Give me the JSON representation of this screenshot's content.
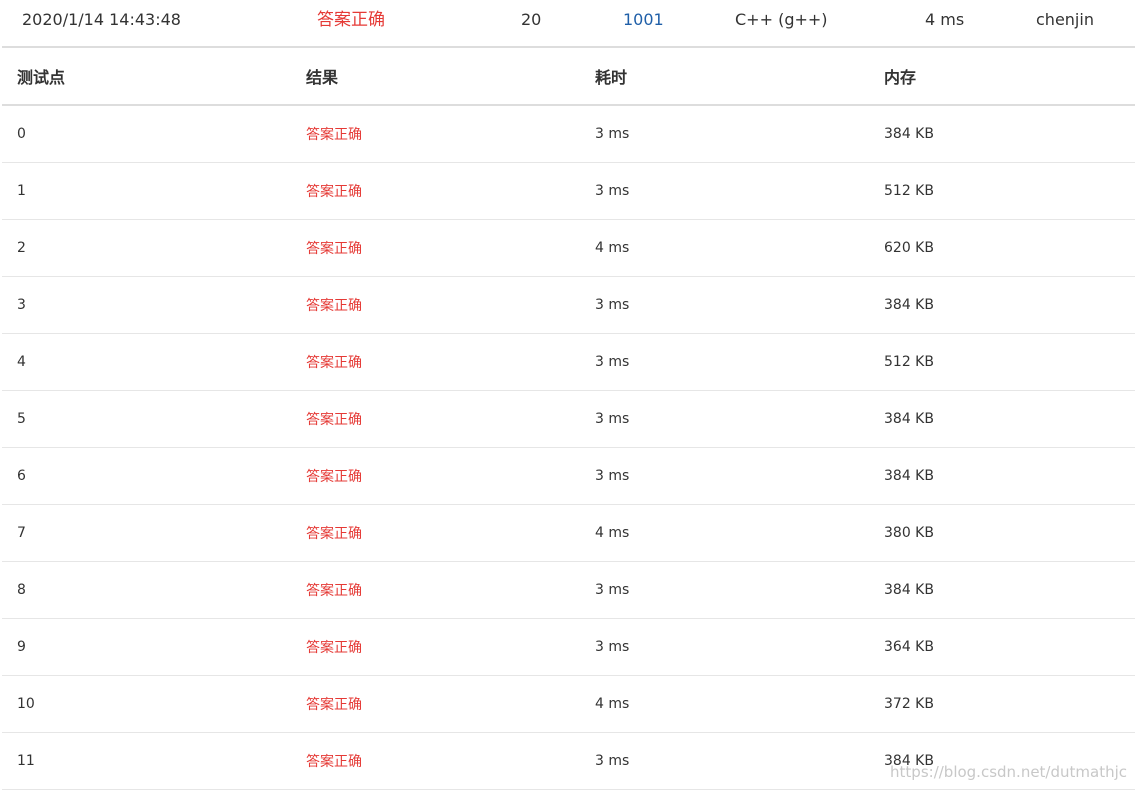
{
  "summary": {
    "submit_time": "2020/1/14 14:43:48",
    "status": "答案正确",
    "score": "20",
    "problem": "1001",
    "language": "C++ (g++)",
    "time_cost": "4 ms",
    "user": "chenjin"
  },
  "table": {
    "headers": {
      "case": "测试点",
      "result": "结果",
      "time": "耗时",
      "memory": "内存"
    },
    "rows": [
      {
        "case": "0",
        "result": "答案正确",
        "time": "3 ms",
        "memory": "384 KB"
      },
      {
        "case": "1",
        "result": "答案正确",
        "time": "3 ms",
        "memory": "512 KB"
      },
      {
        "case": "2",
        "result": "答案正确",
        "time": "4 ms",
        "memory": "620 KB"
      },
      {
        "case": "3",
        "result": "答案正确",
        "time": "3 ms",
        "memory": "384 KB"
      },
      {
        "case": "4",
        "result": "答案正确",
        "time": "3 ms",
        "memory": "512 KB"
      },
      {
        "case": "5",
        "result": "答案正确",
        "time": "3 ms",
        "memory": "384 KB"
      },
      {
        "case": "6",
        "result": "答案正确",
        "time": "3 ms",
        "memory": "384 KB"
      },
      {
        "case": "7",
        "result": "答案正确",
        "time": "4 ms",
        "memory": "380 KB"
      },
      {
        "case": "8",
        "result": "答案正确",
        "time": "3 ms",
        "memory": "384 KB"
      },
      {
        "case": "9",
        "result": "答案正确",
        "time": "3 ms",
        "memory": "364 KB"
      },
      {
        "case": "10",
        "result": "答案正确",
        "time": "4 ms",
        "memory": "372 KB"
      },
      {
        "case": "11",
        "result": "答案正确",
        "time": "3 ms",
        "memory": "384 KB"
      }
    ]
  },
  "watermark": "https://blog.csdn.net/dutmathjc",
  "colors": {
    "accepted": "#e53935",
    "link": "#1f5fa8",
    "text": "#333333",
    "border": "#dddddd"
  }
}
